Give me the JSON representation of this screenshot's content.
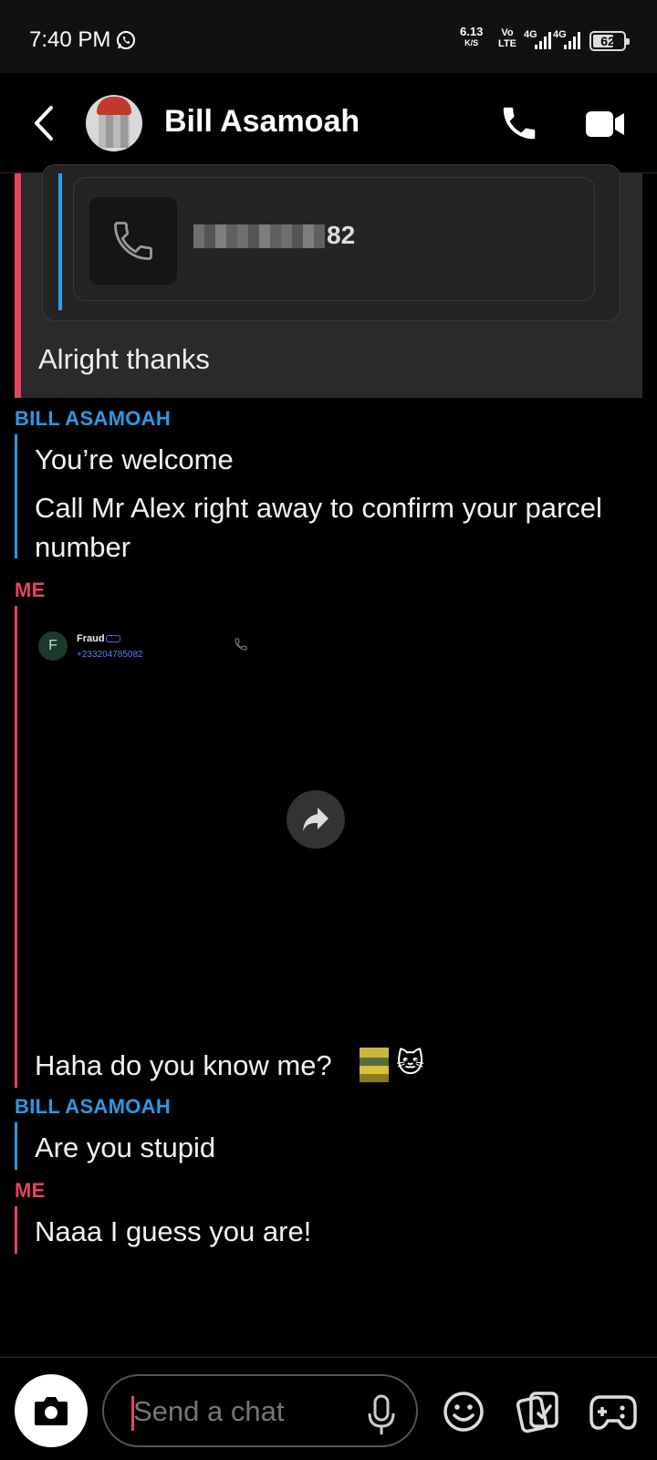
{
  "status_bar": {
    "time": "7:40 PM",
    "net_speed": "6.13",
    "net_speed_unit": "K/S",
    "volte_top": "Vo",
    "volte_bottom": "LTE",
    "signal_1": "4G",
    "signal_2": "4G",
    "battery": "62",
    "icons": [
      "whatsapp-icon",
      "signal-icon",
      "battery-icon"
    ]
  },
  "header": {
    "contact_name": "Bill Asamoah",
    "icons": [
      "back-icon",
      "phone-icon",
      "video-icon"
    ]
  },
  "messages": {
    "quoted": {
      "phone_suffix": "82",
      "reply": "Alright thanks"
    },
    "group_1": {
      "sender": "BILL ASAMOAH",
      "lines": [
        "You’re welcome",
        "Call Mr Alex right away to confirm your parcel number"
      ]
    },
    "group_2": {
      "sender": "ME",
      "screenshot": {
        "avatar_letter": "F",
        "contact": "Fraud",
        "number": "+233204785082"
      },
      "caption": "Haha do you know me?",
      "emoji": "🐱"
    },
    "group_3": {
      "sender": "BILL ASAMOAH",
      "text": "Are you stupid"
    },
    "group_4": {
      "sender": "ME",
      "text": "Naaa I guess you are!"
    }
  },
  "composer": {
    "placeholder": "Send a chat",
    "icons": [
      "camera-icon",
      "mic-icon",
      "emoji-icon",
      "sticker-icon",
      "game-icon"
    ]
  },
  "colors": {
    "me": "#e8425e",
    "friend": "#2b9ae6",
    "background": "#000000"
  }
}
